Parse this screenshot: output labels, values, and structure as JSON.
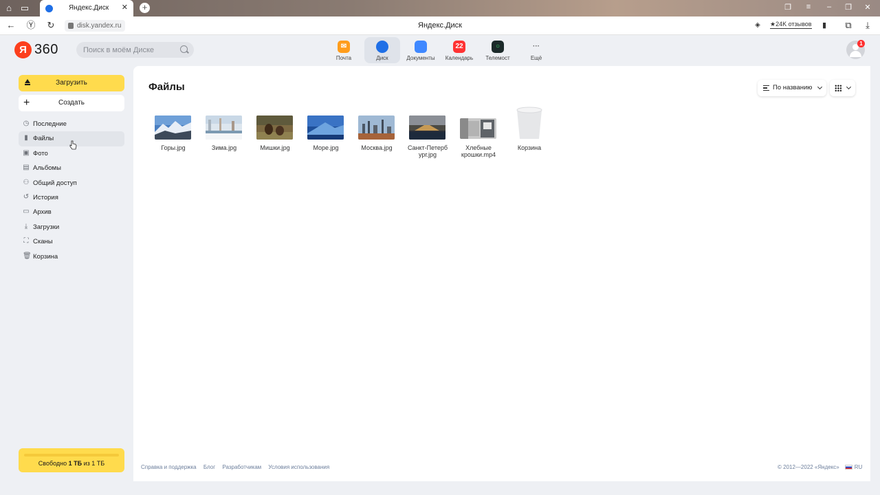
{
  "browser": {
    "tab_title": "Яндекс.Диск",
    "url": "disk.yandex.ru",
    "page_title": "Яндекс.Диск",
    "reviews": "★24K отзывов"
  },
  "header": {
    "logo_ya": "Я",
    "logo_360": "360",
    "search_placeholder": "Поиск в моём Диске",
    "services": [
      {
        "label": "Почта",
        "icon": "mail-icon",
        "color": "#ff9d1c"
      },
      {
        "label": "Диск",
        "icon": "disk-icon",
        "color": "#1f6fe6",
        "active": true
      },
      {
        "label": "Документы",
        "icon": "documents-icon",
        "color": "#3f88ff"
      },
      {
        "label": "Календарь",
        "icon": "calendar-icon",
        "color": "#ff3333",
        "badge": "22"
      },
      {
        "label": "Телемост",
        "icon": "telemost-icon",
        "color": "#1c2a2a"
      },
      {
        "label": "Ещё",
        "icon": "more-icon",
        "glyph": "···"
      }
    ],
    "avatar_badge": "1"
  },
  "sidebar": {
    "upload_label": "Загрузить",
    "create_label": "Создать",
    "items": [
      {
        "label": "Последние",
        "icon": "clock-icon"
      },
      {
        "label": "Файлы",
        "icon": "file-icon",
        "active": true
      },
      {
        "label": "Фото",
        "icon": "photo-icon"
      },
      {
        "label": "Альбомы",
        "icon": "albums-icon"
      },
      {
        "label": "Общий доступ",
        "icon": "shared-icon"
      },
      {
        "label": "История",
        "icon": "history-icon"
      },
      {
        "label": "Архив",
        "icon": "archive-icon"
      },
      {
        "label": "Загрузки",
        "icon": "downloads-icon"
      },
      {
        "label": "Сканы",
        "icon": "scan-icon"
      },
      {
        "label": "Корзина",
        "icon": "trash-icon"
      }
    ],
    "storage_prefix": "Свободно ",
    "storage_value": "1 ТБ",
    "storage_suffix": " из 1 ТБ"
  },
  "main": {
    "title": "Файлы",
    "sort_label": "По названию",
    "files": [
      {
        "name": "Горы.jpg"
      },
      {
        "name": "Зима.jpg"
      },
      {
        "name": "Мишки.jpg"
      },
      {
        "name": "Море.jpg"
      },
      {
        "name": "Москва.jpg"
      },
      {
        "name": "Санкт-Петерб\nург.jpg"
      },
      {
        "name": "Хлебные\nкрошки.mp4"
      },
      {
        "name": "Корзина"
      }
    ]
  },
  "footer": {
    "links": [
      "Справка и поддержка",
      "Блог",
      "Разработчикам",
      "Условия использования"
    ],
    "copyright": "© 2012—2022 «Яндекс»",
    "lang": "RU"
  },
  "colors": {
    "accent": "#ffdb4d",
    "brand_red": "#fc3f1d",
    "background": "#eef0f4"
  }
}
